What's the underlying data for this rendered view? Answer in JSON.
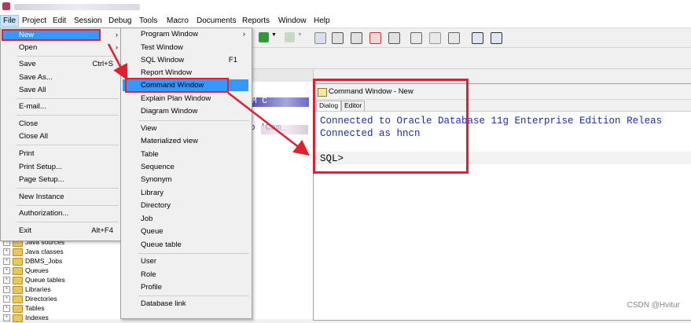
{
  "menubar": {
    "items": [
      "File",
      "Project",
      "Edit",
      "Session",
      "Debug",
      "Tools",
      "Macro",
      "Documents",
      "Reports",
      "Window",
      "Help"
    ]
  },
  "file_menu": {
    "groups": [
      [
        {
          "label": "New",
          "shortcut": "",
          "arrow": "›"
        },
        {
          "label": "Open",
          "shortcut": "",
          "arrow": "›"
        }
      ],
      [
        {
          "label": "Save",
          "shortcut": "Ctrl+S"
        },
        {
          "label": "Save As..."
        },
        {
          "label": "Save All"
        }
      ],
      [
        {
          "label": "E-mail..."
        }
      ],
      [
        {
          "label": "Close"
        },
        {
          "label": "Close All"
        }
      ],
      [
        {
          "label": "Print"
        },
        {
          "label": "Print Setup..."
        },
        {
          "label": "Page Setup..."
        }
      ],
      [
        {
          "label": "New Instance"
        }
      ],
      [
        {
          "label": "Authorization..."
        }
      ],
      [
        {
          "label": "Exit",
          "shortcut": "Alt+F4"
        }
      ]
    ]
  },
  "new_menu": {
    "items": [
      {
        "label": "Program Window",
        "arrow": "›"
      },
      {
        "label": "Test Window"
      },
      {
        "label": "SQL Window",
        "shortcut": "F1"
      },
      {
        "label": "Report Window"
      },
      {
        "label": "Command Window",
        "selected": true
      },
      {
        "label": "Explain Plan Window"
      },
      {
        "label": "Diagram Window"
      },
      {
        "label": "View"
      },
      {
        "label": "Materialized view"
      },
      {
        "label": "Table"
      },
      {
        "label": "Sequence"
      },
      {
        "label": "Synonym"
      },
      {
        "label": "Library"
      },
      {
        "label": "Directory"
      },
      {
        "label": "Job"
      },
      {
        "label": "Queue"
      },
      {
        "label": "Queue table"
      },
      {
        "label": "User"
      },
      {
        "label": "Role"
      },
      {
        "label": "Profile"
      },
      {
        "label": "Database link"
      }
    ]
  },
  "tree": {
    "items": [
      "Java sources",
      "Java classes",
      "DBMS_Jobs",
      "Queues",
      "Queue tables",
      "Libraries",
      "Directories",
      "Tables",
      "Indexes"
    ]
  },
  "editor": {
    "fragment1": "M C",
    "fragment2": "o 'Com_"
  },
  "command_window": {
    "title": "Command Window - New",
    "tabs": [
      "Dialog",
      "Editor"
    ],
    "lines": [
      "Connected to Oracle Database 11g Enterprise Edition Releas",
      "Connected as hncn"
    ],
    "prompt": "SQL>"
  },
  "watermark": "CSDN @Hvitur",
  "colors": {
    "highlight": "#3399ff",
    "annotation_red": "#e0202e",
    "console_text": "#1b2ea6"
  }
}
